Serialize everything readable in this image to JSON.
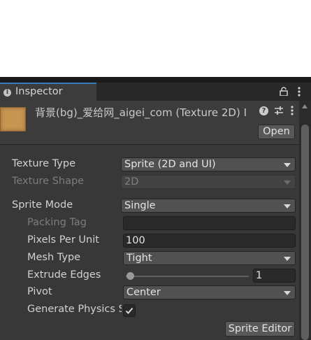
{
  "tab": {
    "icon": "info-icon",
    "label": "Inspector"
  },
  "header": {
    "title": "背景(bg)_爱给网_aigei_com (Texture 2D) I",
    "open_label": "Open"
  },
  "properties": {
    "texture_type": {
      "label": "Texture Type",
      "value": "Sprite (2D and UI)"
    },
    "texture_shape": {
      "label": "Texture Shape",
      "value": "2D"
    },
    "sprite_mode": {
      "label": "Sprite Mode",
      "value": "Single"
    },
    "packing_tag": {
      "label": "Packing Tag",
      "value": ""
    },
    "pixels_per_unit": {
      "label": "Pixels Per Unit",
      "value": "100"
    },
    "mesh_type": {
      "label": "Mesh Type",
      "value": "Tight"
    },
    "extrude_edges": {
      "label": "Extrude Edges",
      "value": "1"
    },
    "pivot": {
      "label": "Pivot",
      "value": "Center"
    },
    "generate_physics_shape": {
      "label": "Generate Physics Shape",
      "checked": true
    }
  },
  "sprite_editor_label": "Sprite Editor",
  "colors": {
    "panel_bg": "#383838",
    "tab_accent": "#3a79bb",
    "thumbnail": "#c79652"
  }
}
